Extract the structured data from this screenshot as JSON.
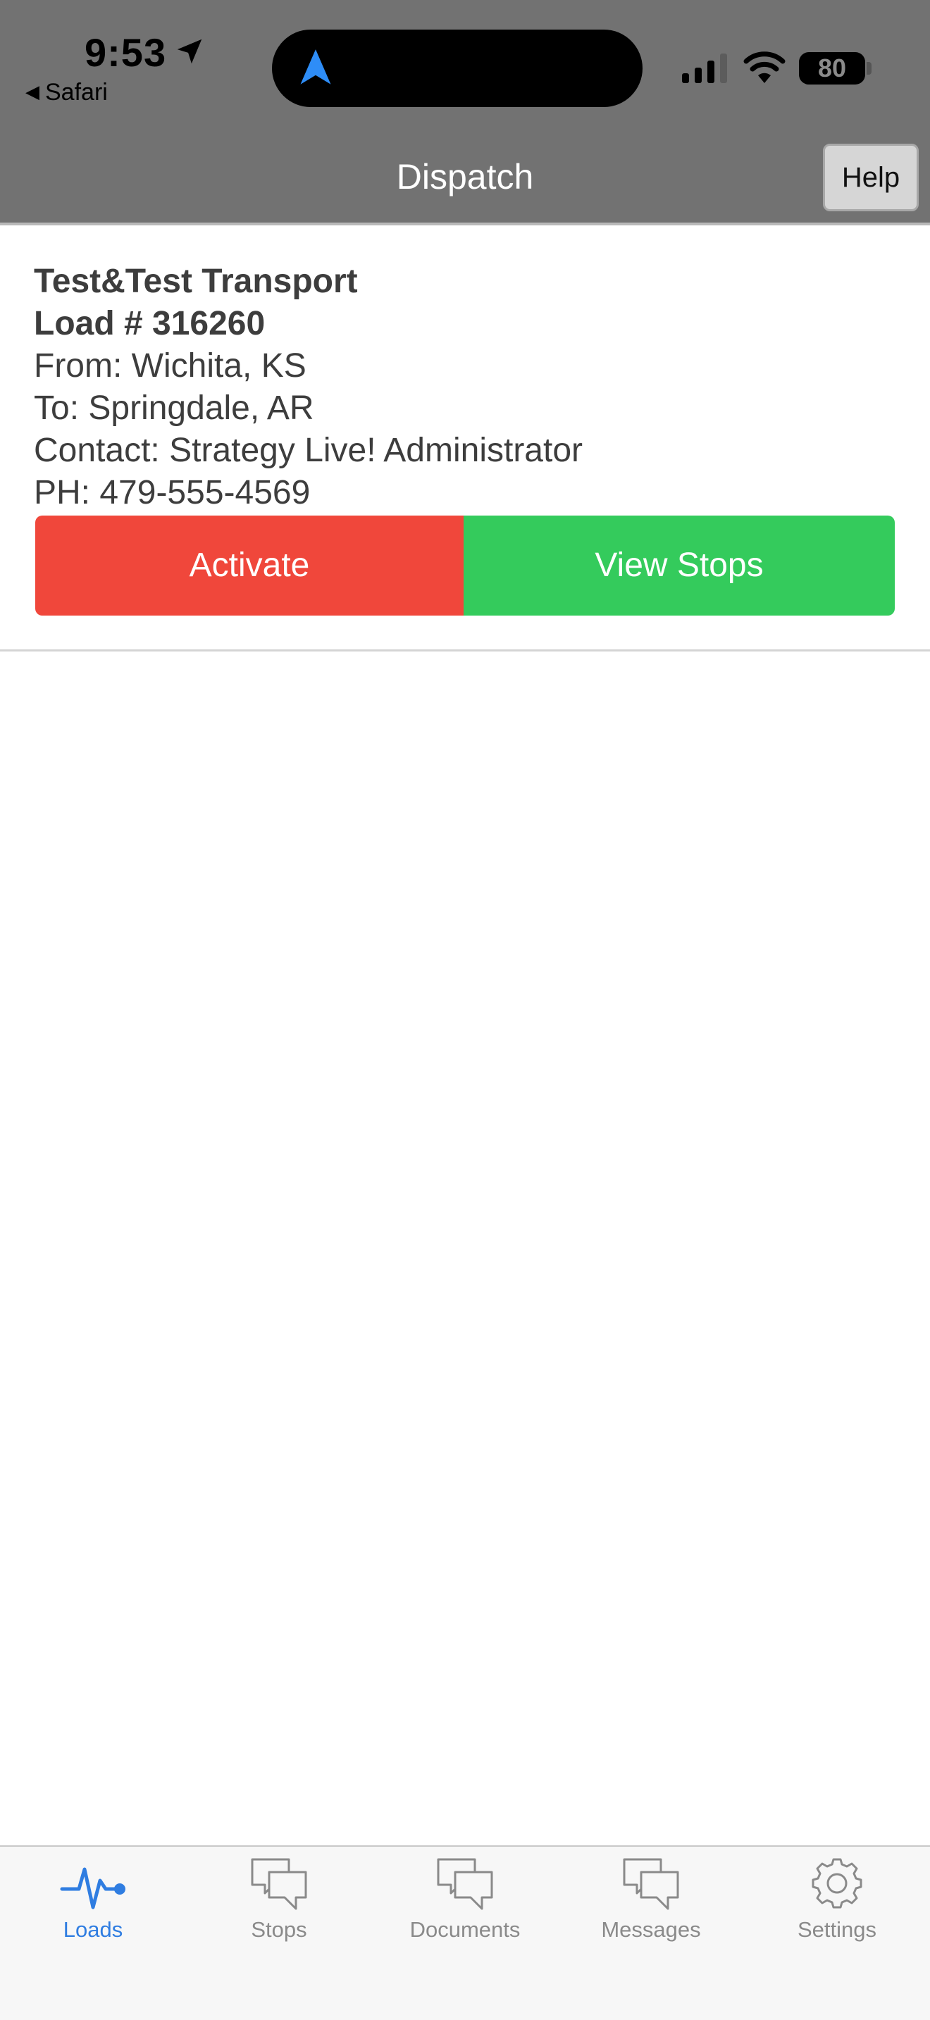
{
  "status_bar": {
    "time": "9:53",
    "back_label": "Safari",
    "battery": "80"
  },
  "header": {
    "title": "Dispatch",
    "help_label": "Help"
  },
  "load": {
    "company": "Test&Test Transport",
    "load_number": "Load # 316260",
    "from": "From: Wichita, KS",
    "to": "To: Springdale, AR",
    "contact": "Contact: Strategy Live! Administrator",
    "phone": "PH: 479-555-4569",
    "activate_label": "Activate",
    "view_stops_label": "View Stops"
  },
  "tabs": [
    {
      "label": "Loads",
      "icon": "activity-pulse-icon",
      "active": true
    },
    {
      "label": "Stops",
      "icon": "chat-bubbles-icon",
      "active": false
    },
    {
      "label": "Documents",
      "icon": "chat-bubbles-icon",
      "active": false
    },
    {
      "label": "Messages",
      "icon": "chat-bubbles-icon",
      "active": false
    },
    {
      "label": "Settings",
      "icon": "gear-icon",
      "active": false
    }
  ],
  "colors": {
    "header_bg": "#727272",
    "activate": "#f0473b",
    "view_stops": "#34cb5c",
    "tab_active": "#2f7de1",
    "tab_inactive": "#8a8a8a"
  }
}
